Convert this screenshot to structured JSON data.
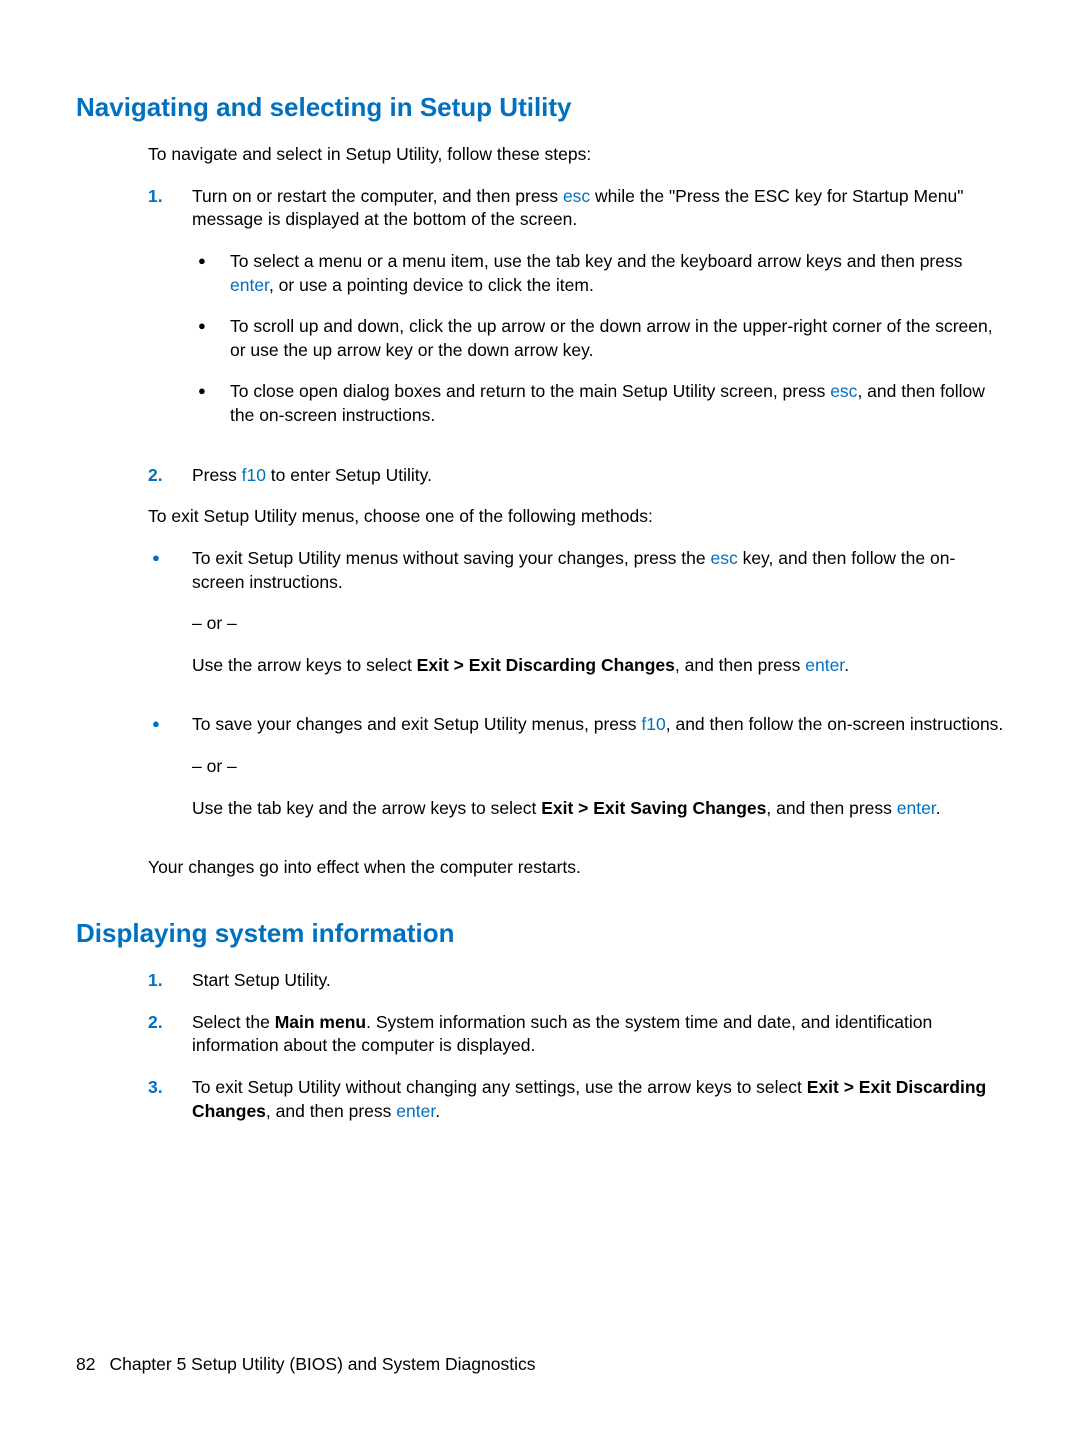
{
  "section1": {
    "heading": "Navigating and selecting in Setup Utility",
    "intro": "To navigate and select in Setup Utility, follow these steps:",
    "step1": {
      "marker": "1.",
      "text_a": "Turn on or restart the computer, and then press ",
      "key_esc": "esc",
      "text_b": " while the \"Press the ESC key for Startup Menu\" message is displayed at the bottom of the screen.",
      "bullets": {
        "b1_a": "To select a menu or a menu item, use the tab key and the keyboard arrow keys and then press ",
        "b1_key": "enter",
        "b1_b": ", or use a pointing device to click the item.",
        "b2": "To scroll up and down, click the up arrow or the down arrow in the upper-right corner of the screen, or use the up arrow key or the down arrow key.",
        "b3_a": "To close open dialog boxes and return to the main Setup Utility screen, press ",
        "b3_key": "esc",
        "b3_b": ", and then follow the on-screen instructions."
      }
    },
    "step2": {
      "marker": "2.",
      "text_a": "Press ",
      "key": "f10",
      "text_b": " to enter Setup Utility."
    },
    "exit_intro": "To exit Setup Utility menus, choose one of the following methods:",
    "exit_b1": {
      "text_a": "To exit Setup Utility menus without saving your changes, press the ",
      "key": "esc",
      "text_b": " key, and then follow the on-screen instructions.",
      "or": "– or –",
      "alt_a": "Use the arrow keys to select ",
      "alt_bold": "Exit > Exit Discarding Changes",
      "alt_b": ", and then press ",
      "alt_key": "enter",
      "alt_c": "."
    },
    "exit_b2": {
      "text_a": "To save your changes and exit Setup Utility menus, press ",
      "key": "f10",
      "text_b": ", and then follow the on-screen instructions.",
      "or": "– or –",
      "alt_a": "Use the tab key and the arrow keys to select ",
      "alt_bold": "Exit > Exit Saving Changes",
      "alt_b": ", and then press ",
      "alt_key": "enter",
      "alt_c": "."
    },
    "outro": "Your changes go into effect when the computer restarts."
  },
  "section2": {
    "heading": "Displaying system information",
    "step1": {
      "marker": "1.",
      "text": "Start Setup Utility."
    },
    "step2": {
      "marker": "2.",
      "text_a": "Select the ",
      "bold": "Main menu",
      "text_b": ". System information such as the system time and date, and identification information about the computer is displayed."
    },
    "step3": {
      "marker": "3.",
      "text_a": "To exit Setup Utility without changing any settings, use the arrow keys to select ",
      "bold": "Exit > Exit Discarding Changes",
      "text_b": ", and then press ",
      "key": "enter",
      "text_c": "."
    }
  },
  "footer": {
    "page": "82",
    "chapter": "Chapter 5   Setup Utility (BIOS) and System Diagnostics"
  },
  "glyphs": {
    "disc": "●"
  }
}
